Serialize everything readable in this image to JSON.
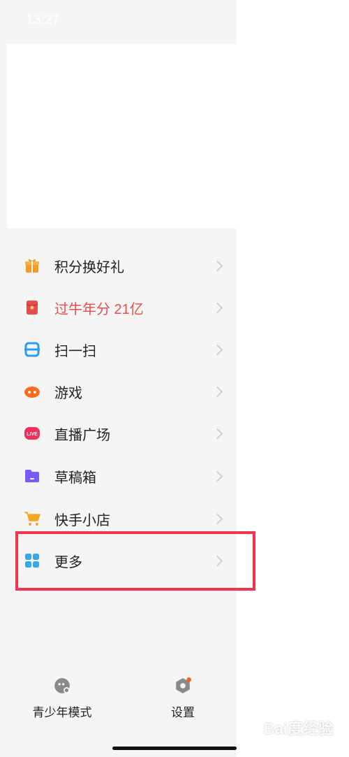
{
  "status_bar": {
    "time": "13:27"
  },
  "menu": {
    "items": [
      {
        "label": "积分换好礼",
        "icon": "gift-icon",
        "color": "#f59a23"
      },
      {
        "label": "过牛年分 21亿",
        "icon": "red-envelope-icon",
        "color": "#e84d4d"
      },
      {
        "label": "扫一扫",
        "icon": "scan-icon",
        "color": "#2a9df4"
      },
      {
        "label": "游戏",
        "icon": "game-controller-icon",
        "color": "#ff6a1a"
      },
      {
        "label": "直播广场",
        "icon": "live-icon",
        "color": "#f0305a"
      },
      {
        "label": "草稿箱",
        "icon": "folder-icon",
        "color": "#7a5af8"
      },
      {
        "label": "快手小店",
        "icon": "shopping-cart-icon",
        "color": "#f5a623"
      },
      {
        "label": "更多",
        "icon": "grid-icon",
        "color": "#36a8e6"
      }
    ]
  },
  "bottom": {
    "youth_mode": "青少年模式",
    "settings": "设置"
  },
  "watermark": "Bai度经验"
}
